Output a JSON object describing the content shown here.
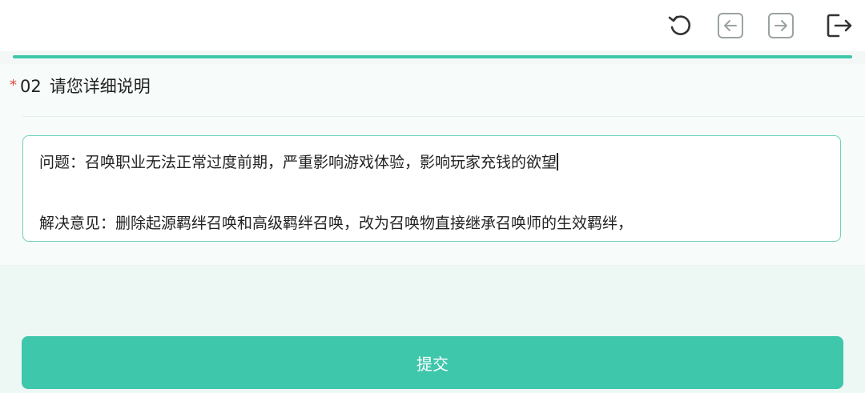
{
  "toolbar": {
    "icons": [
      "refresh-icon",
      "back-arrow-icon",
      "forward-arrow-icon",
      "exit-icon"
    ]
  },
  "progress": {
    "fraction": 1.0,
    "color": "#3ec7ab"
  },
  "question": {
    "required_marker": "*",
    "number": "02",
    "title": "请您详细说明"
  },
  "answer": {
    "line1": "问题：召唤职业无法正常过度前期，严重影响游戏体验，影响玩家充钱的欲望",
    "line2": "",
    "line3": "解决意见：删除起源羁绊召唤和高级羁绊召唤，改为召唤物直接继承召唤师的生效羁绊，"
  },
  "submit": {
    "label": "提交"
  },
  "colors": {
    "accent": "#3ec7ab",
    "required": "#e5483c",
    "page_background": "#edf7f4"
  }
}
